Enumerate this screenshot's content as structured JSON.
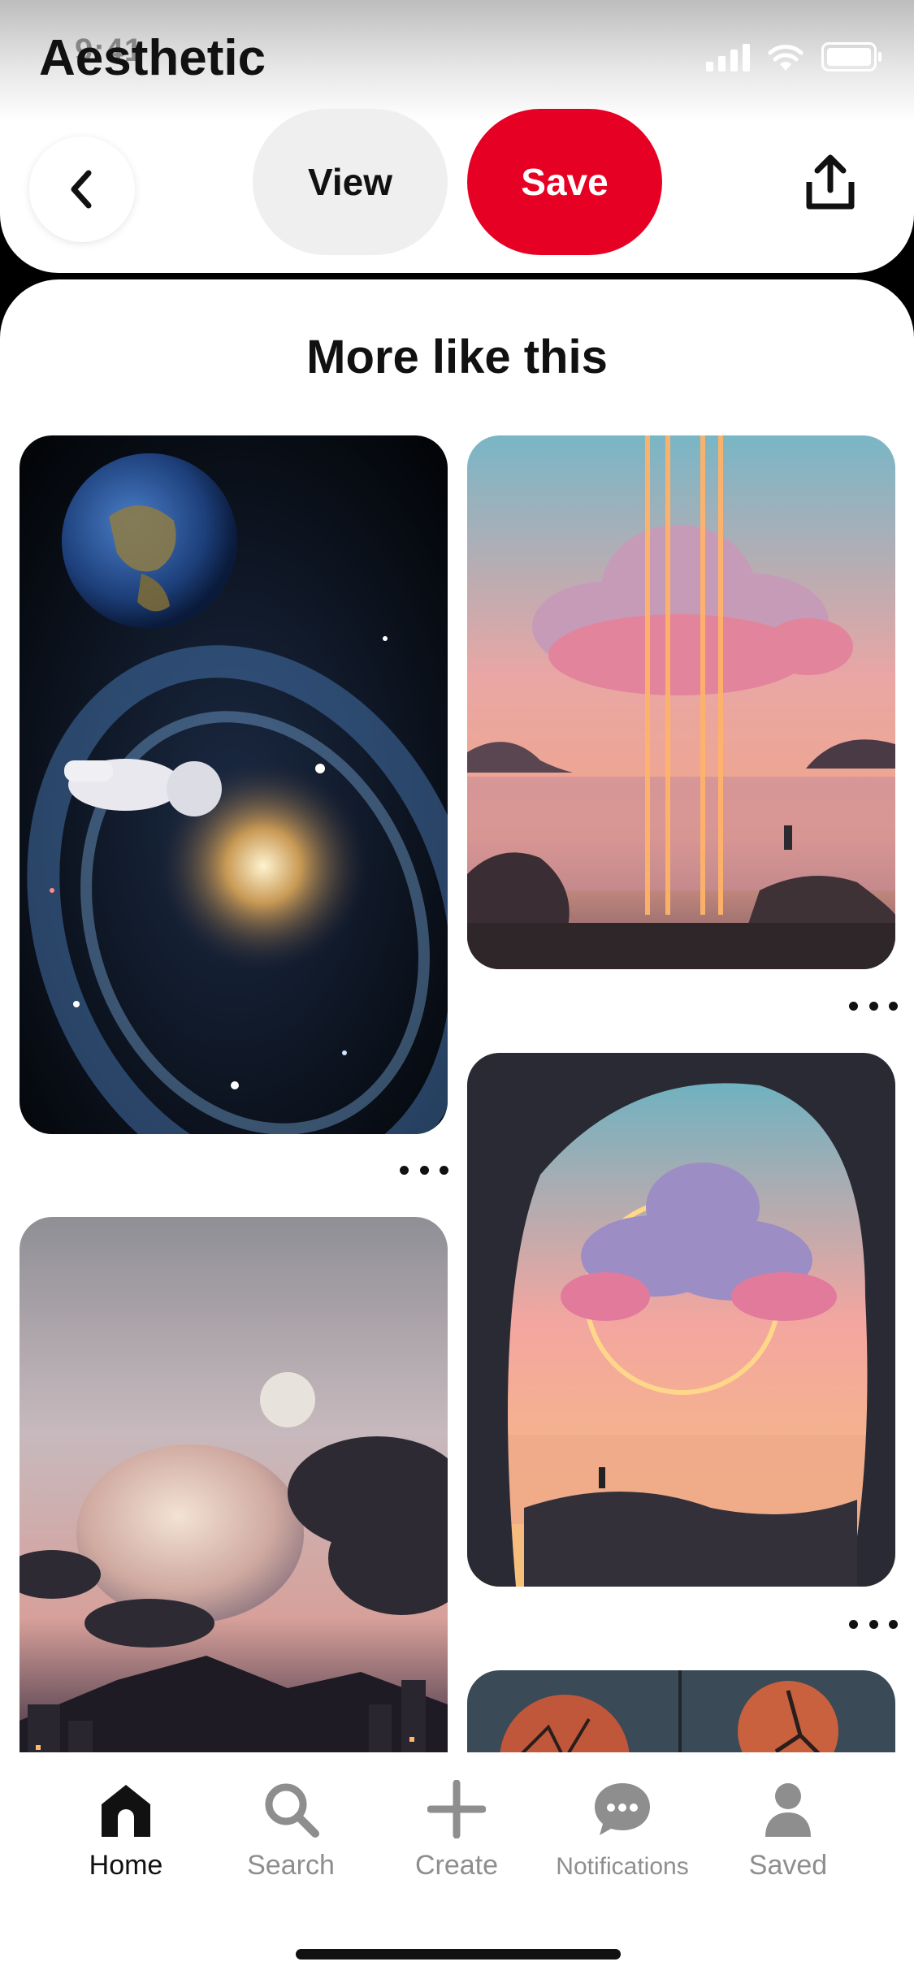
{
  "status_bar": {
    "time": "9:41"
  },
  "board": {
    "title": "Aesthetic"
  },
  "actions": {
    "view_label": "View",
    "save_label": "Save"
  },
  "section": {
    "title": "More like this"
  },
  "pins": [
    {
      "kind": "space galaxy with earth and astronaut"
    },
    {
      "kind": "glowing cloud with light beams over sea"
    },
    {
      "kind": "cloud with neon ring seen from cave"
    },
    {
      "kind": "large planet over city at dusk"
    },
    {
      "kind": "red moons with tree silhouette"
    }
  ],
  "nav": {
    "items": [
      {
        "label": "Home",
        "icon": "home-icon",
        "active": true
      },
      {
        "label": "Search",
        "icon": "search-icon",
        "active": false
      },
      {
        "label": "Create",
        "icon": "plus-icon",
        "active": false
      },
      {
        "label": "Notifications",
        "icon": "chat-bubble-icon",
        "active": false
      },
      {
        "label": "Saved",
        "icon": "profile-icon",
        "active": false
      }
    ]
  },
  "colors": {
    "brand_red": "#e60023",
    "pill_gray": "#efefef"
  }
}
